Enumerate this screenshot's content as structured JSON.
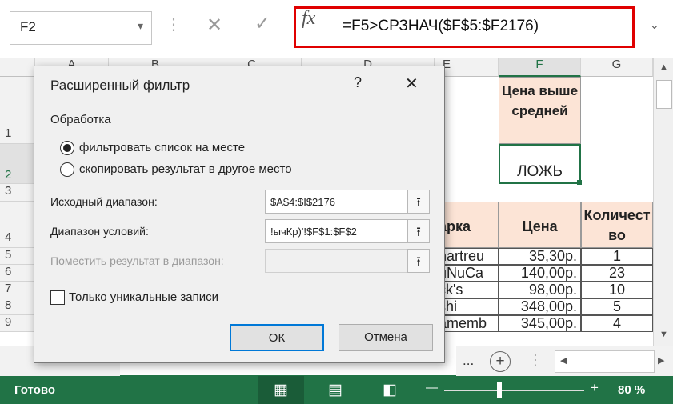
{
  "formula_bar": {
    "name_box": "F2",
    "fx": "fx",
    "cancel_glyph": "✕",
    "enter_glyph": "✓",
    "formula": "=F5>СРЗНАЧ($F$5:$F2176)"
  },
  "columns": [
    "A",
    "B",
    "C",
    "D",
    "E",
    "F",
    "G"
  ],
  "rows": [
    "1",
    "2",
    "3",
    "4",
    "5",
    "6",
    "7",
    "8",
    "9"
  ],
  "cells": {
    "f1": "Цена выше средней",
    "f2": "ЛОЖЬ",
    "e4": "арка",
    "f4": "Цена",
    "g4": "Количество",
    "data": [
      {
        "e": "hartreu",
        "f": "35,30р.",
        "g": "1"
      },
      {
        "e": "uNuCa",
        "f": "140,00р.",
        "g": "23"
      },
      {
        "e": "ck's",
        "f": "98,00р.",
        "g": "10"
      },
      {
        "e": "shi",
        "f": "348,00р.",
        "g": "5"
      },
      {
        "e": "amemb",
        "f": "345,00р.",
        "g": "4"
      }
    ]
  },
  "sheet_tabs": {
    "ellipsis": "...",
    "add": "+"
  },
  "dialog": {
    "title": "Расширенный фильтр",
    "help": "?",
    "close": "✕",
    "group_label": "Обработка",
    "radio1": "фильтровать список на месте",
    "radio2": "скопировать результат в другое место",
    "source_label": "Исходный диапазон:",
    "source_value": "$A$4:$I$2176",
    "criteria_label": "Диапазон условий:",
    "criteria_value": "!ычКр)'!$F$1:$F$2",
    "copyto_label": "Поместить результат в диапазон:",
    "copyto_value": "",
    "unique_label": "Только уникальные записи",
    "ok": "ОК",
    "cancel": "Отмена"
  },
  "status": {
    "ready": "Готово",
    "zoom": "80 %",
    "minus": "—",
    "plus": "+"
  },
  "colors": {
    "accent_green": "#217346",
    "header_fill": "#fce4d6",
    "red_highlight": "#e00000"
  }
}
